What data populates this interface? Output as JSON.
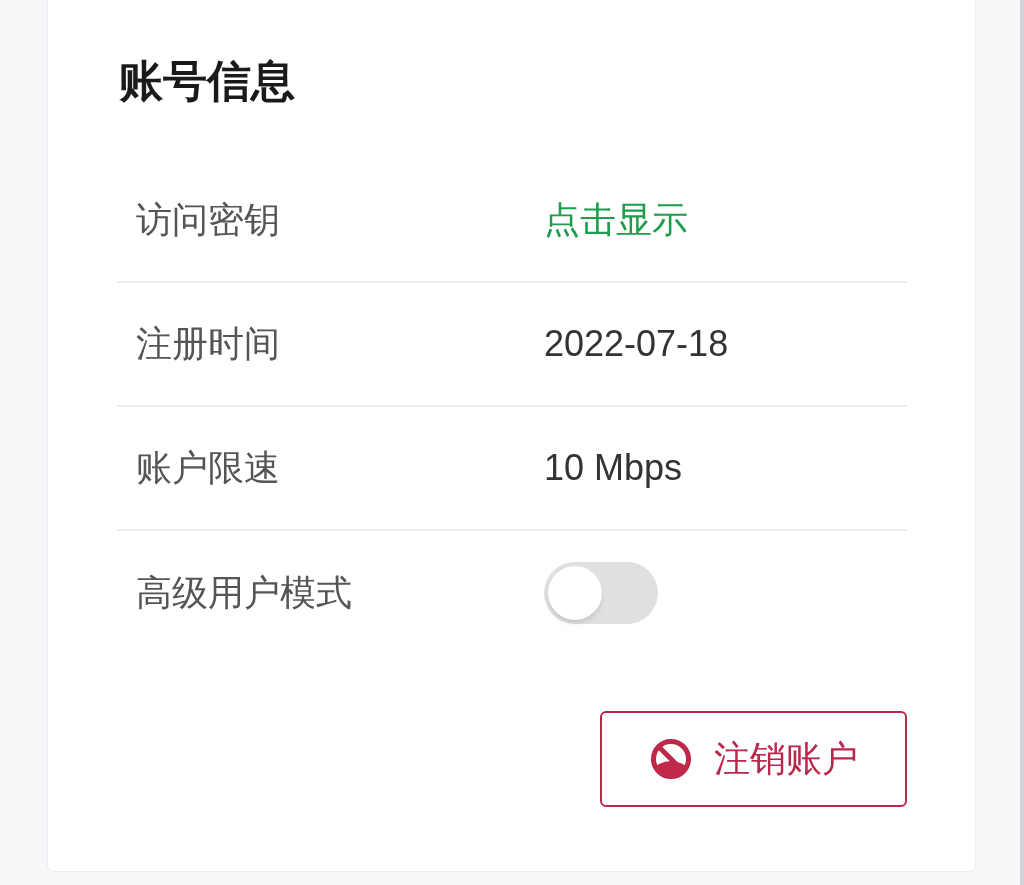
{
  "card": {
    "title": "账号信息",
    "rows": [
      {
        "label": "访问密钥",
        "kind": "link",
        "value": "点击显示"
      },
      {
        "label": "注册时间",
        "kind": "text",
        "value": "2022-07-18"
      },
      {
        "label": "账户限速",
        "kind": "text",
        "value": "10 Mbps"
      },
      {
        "label": "高级用户模式",
        "kind": "toggle",
        "on": false
      }
    ],
    "button": {
      "label": "注销账户"
    }
  }
}
